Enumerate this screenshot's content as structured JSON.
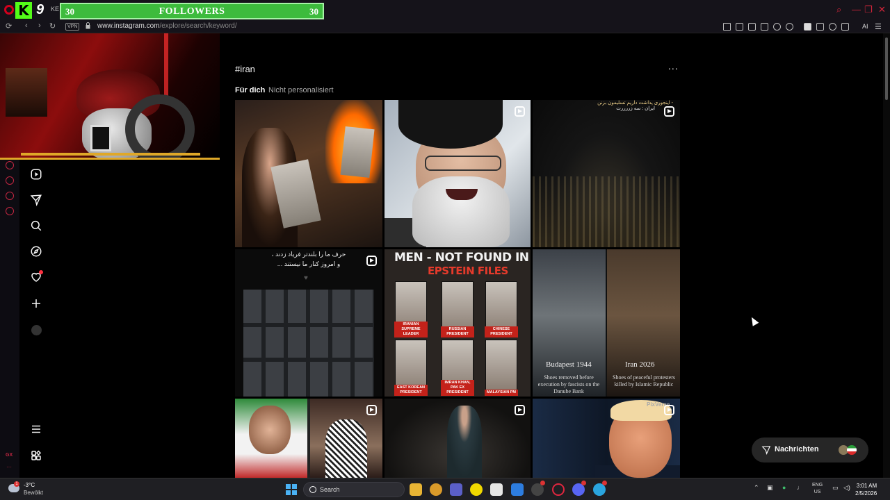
{
  "browser": {
    "tab_fragment": "KE",
    "url_host": "www.instagram.com",
    "url_path": "/explore/search/keyword/",
    "vpn_label": "VPN",
    "ai_label": "AI",
    "accent": "#d3253a"
  },
  "overlay": {
    "followers_left": "30",
    "followers_title": "FOLLOWERS",
    "followers_right": "30",
    "bar_color": "#3dbb3d"
  },
  "instagram": {
    "hashtag": "#iran",
    "more_label": "...",
    "tab_active": "Für dich",
    "tab_inactive": "Nicht personalisiert",
    "nav_icons": [
      "reels-icon",
      "messages-icon",
      "search-icon",
      "explore-icon",
      "notifications-icon",
      "create-icon",
      "profile-icon",
      "menu-icon",
      "threads-icon"
    ],
    "posts": {
      "p3_caption_1": "- اینجوری پذاشت داریم تسلیمون بزنن",
      "p3_caption_2": "ایران : سه زررررت",
      "p4_caption_line1": "حرف ما را بلندتر فریاد زدند ،",
      "p4_caption_line2": "و امروز کنار ما نیستند ...",
      "p5_title_1": "MEN -",
      "p5_title_1b": "NOT FOUND IN",
      "p5_title_2": "EPSTEIN FILES",
      "p5_labels": [
        "IRANIAN SUPREME LEADER",
        "RUSSIAN PRESIDENT",
        "CHINESE PRESIDENT",
        "EAST KOREAN PRESIDENT",
        "IMRAN KHAN, PAK EX PRESIDENT",
        "MALAYSIAN PM"
      ],
      "p6_left_title": "Budapest 1944",
      "p6_left_sub": "Shoes removed before execution by fascists on the Danube Bank",
      "p6_right_title": "Iran 2026",
      "p6_right_sub": "Shoes of peaceful protesters killed by Islamic Republic",
      "p9_watermark": "PixVerse"
    },
    "messages_label": "Nachrichten"
  },
  "taskbar": {
    "temperature": "-3°C",
    "condition": "Bewölkt",
    "weather_badge": "1",
    "search_label": "Search",
    "lang_1": "ENG",
    "lang_2": "US",
    "time": "3:01 AM",
    "date": "2/5/2026"
  }
}
